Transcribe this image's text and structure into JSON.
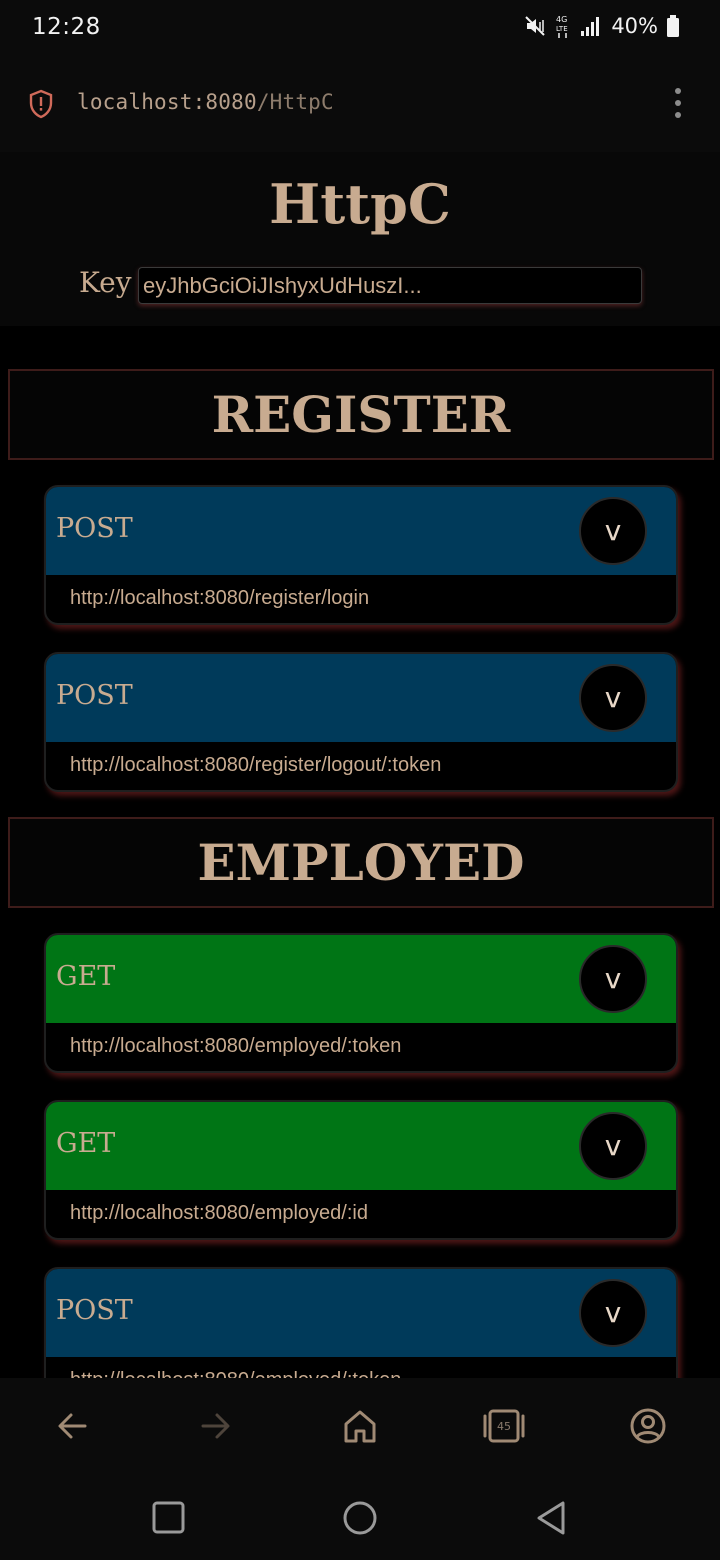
{
  "status_bar": {
    "time": "12:28",
    "battery": "40%",
    "icons": [
      "mute-vibrate-icon",
      "4g-lte-icon",
      "signal-icon",
      "battery-icon"
    ]
  },
  "browser": {
    "url_host": "localhost:8080",
    "url_path": "/HttpC",
    "tab_count": "45"
  },
  "app": {
    "title": "HttpC",
    "key_label": "Key",
    "key_value": "eyJhbGciOiJIshyxUdHuszI..."
  },
  "sections": [
    {
      "title": "REGISTER",
      "endpoints": [
        {
          "method": "POST",
          "url": "http://localhost:8080/register/login",
          "toggle": "v"
        },
        {
          "method": "POST",
          "url": "http://localhost:8080/register/logout/:token",
          "toggle": "v"
        }
      ]
    },
    {
      "title": "EMPLOYED",
      "endpoints": [
        {
          "method": "GET",
          "url": "http://localhost:8080/employed/:token",
          "toggle": "v"
        },
        {
          "method": "GET",
          "url": "http://localhost:8080/employed/:id",
          "toggle": "v"
        },
        {
          "method": "POST",
          "url": "http://localhost:8080/employed/:token",
          "toggle": "v"
        }
      ]
    }
  ],
  "colors": {
    "post": "#003a5a",
    "get": "#007515",
    "text": "#c8ab90",
    "background": "#000000"
  }
}
